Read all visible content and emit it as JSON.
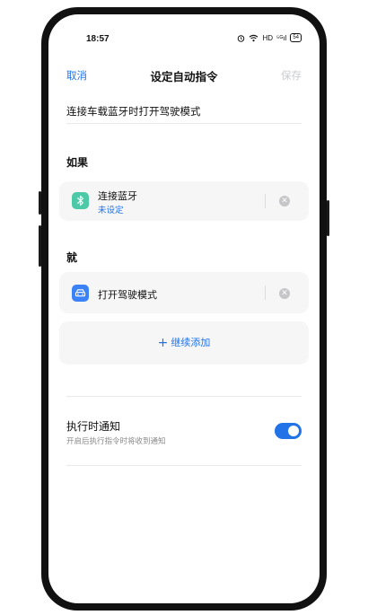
{
  "status_bar": {
    "time": "18:57",
    "hd": "HD",
    "signal": "⁵ᴳıl",
    "battery": "54"
  },
  "nav": {
    "cancel": "取消",
    "title": "设定自动指令",
    "save": "保存"
  },
  "rule_name": "连接车载蓝牙时打开驾驶模式",
  "if_section": {
    "label": "如果",
    "condition": {
      "title": "连接蓝牙",
      "subtitle": "未设定",
      "icon": "bluetooth-icon",
      "icon_color": "#4cc9a7"
    }
  },
  "then_section": {
    "label": "就",
    "action": {
      "title": "打开驾驶模式",
      "icon": "car-icon",
      "icon_color": "#3b82f6"
    },
    "add_more": "继续添加"
  },
  "notify": {
    "title": "执行时通知",
    "subtitle": "开启后执行指令时将收到通知",
    "enabled": true
  },
  "colors": {
    "accent": "#2373e8",
    "card_bg": "#f6f6f7"
  }
}
